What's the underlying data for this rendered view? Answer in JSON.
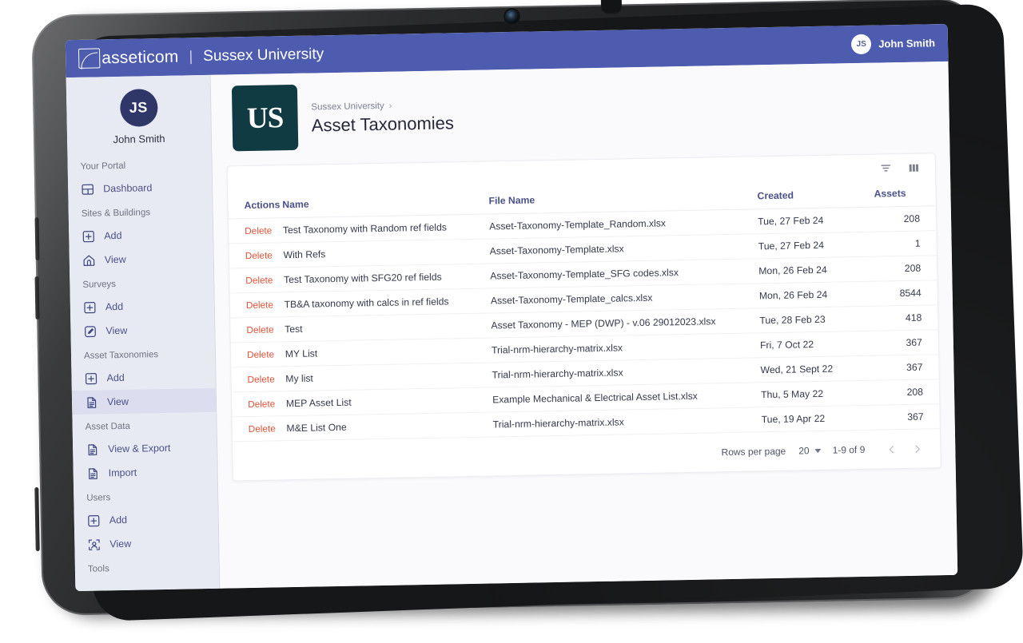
{
  "topbar": {
    "logo_icon": "asseticom-logo-icon",
    "brand_name": "asseticom",
    "separator": "|",
    "tenant_name": "Sussex University",
    "user_initials": "JS",
    "user_name": "John Smith"
  },
  "sidebar": {
    "profile": {
      "initials": "JS",
      "name": "John Smith"
    },
    "groups": [
      {
        "label": "Your Portal",
        "items": [
          {
            "label": "Dashboard",
            "icon": "dashboard-icon",
            "active": false
          }
        ]
      },
      {
        "label": "Sites & Buildings",
        "items": [
          {
            "label": "Add",
            "icon": "plus-square-icon",
            "active": false
          },
          {
            "label": "View",
            "icon": "home-icon",
            "active": false
          }
        ]
      },
      {
        "label": "Surveys",
        "items": [
          {
            "label": "Add",
            "icon": "plus-square-icon",
            "active": false
          },
          {
            "label": "View",
            "icon": "edit-square-icon",
            "active": false
          }
        ]
      },
      {
        "label": "Asset Taxonomies",
        "items": [
          {
            "label": "Add",
            "icon": "plus-square-icon",
            "active": false
          },
          {
            "label": "View",
            "icon": "document-icon",
            "active": true
          }
        ]
      },
      {
        "label": "Asset Data",
        "items": [
          {
            "label": "View & Export",
            "icon": "document-icon",
            "active": false
          },
          {
            "label": "Import",
            "icon": "document-icon",
            "active": false
          }
        ]
      },
      {
        "label": "Users",
        "items": [
          {
            "label": "Add",
            "icon": "plus-square-icon",
            "active": false
          },
          {
            "label": "View",
            "icon": "user-scan-icon",
            "active": false
          }
        ]
      },
      {
        "label": "Tools",
        "items": []
      }
    ]
  },
  "page": {
    "tenant_logo_text": "US",
    "breadcrumb": "Sussex University",
    "breadcrumb_caret": "›",
    "title": "Asset Taxonomies"
  },
  "toolbar": {
    "filter_icon": "filter-icon",
    "columns_icon": "columns-icon"
  },
  "table": {
    "columns": [
      "Actions",
      "Name",
      "File Name",
      "Created",
      "Assets"
    ],
    "action_label": "Delete",
    "rows": [
      {
        "action": "Delete",
        "name": "Test Taxonomy with Random ref fields",
        "file_name": "Asset-Taxonomy-Template_Random.xlsx",
        "created": "Tue, 27 Feb 24",
        "assets": "208"
      },
      {
        "action": "Delete",
        "name": "With Refs",
        "file_name": "Asset-Taxonomy-Template.xlsx",
        "created": "Tue, 27 Feb 24",
        "assets": "1"
      },
      {
        "action": "Delete",
        "name": "Test Taxonomy with SFG20 ref fields",
        "file_name": "Asset-Taxonomy-Template_SFG codes.xlsx",
        "created": "Mon, 26 Feb 24",
        "assets": "208"
      },
      {
        "action": "Delete",
        "name": "TB&A taxonomy with calcs in ref fields",
        "file_name": "Asset-Taxonomy-Template_calcs.xlsx",
        "created": "Mon, 26 Feb 24",
        "assets": "8544"
      },
      {
        "action": "Delete",
        "name": "Test",
        "file_name": "Asset Taxonomy - MEP (DWP) - v.06 29012023.xlsx",
        "created": "Tue, 28 Feb 23",
        "assets": "418"
      },
      {
        "action": "Delete",
        "name": "MY List",
        "file_name": "Trial-nrm-hierarchy-matrix.xlsx",
        "created": "Fri, 7 Oct 22",
        "assets": "367"
      },
      {
        "action": "Delete",
        "name": "My list",
        "file_name": "Trial-nrm-hierarchy-matrix.xlsx",
        "created": "Wed, 21 Sept 22",
        "assets": "367"
      },
      {
        "action": "Delete",
        "name": "MEP Asset List",
        "file_name": "Example Mechanical & Electrical Asset List.xlsx",
        "created": "Thu, 5 May 22",
        "assets": "208"
      },
      {
        "action": "Delete",
        "name": "M&E List One",
        "file_name": "Trial-nrm-hierarchy-matrix.xlsx",
        "created": "Tue, 19 Apr 22",
        "assets": "367"
      }
    ]
  },
  "pagination": {
    "rows_per_page_label": "Rows per page",
    "rows_per_page_value": "20",
    "range": "1-9 of 9",
    "prev_icon": "chevron-left-icon",
    "next_icon": "chevron-right-icon"
  },
  "colors": {
    "header_blue": "#4d5cae",
    "sidebar_bg": "#e8eaf3",
    "sidebar_active": "#dcdef0",
    "tenant_logo_bg": "#113b42",
    "delete_red": "#e0533c",
    "link_navy": "#4a5188"
  }
}
